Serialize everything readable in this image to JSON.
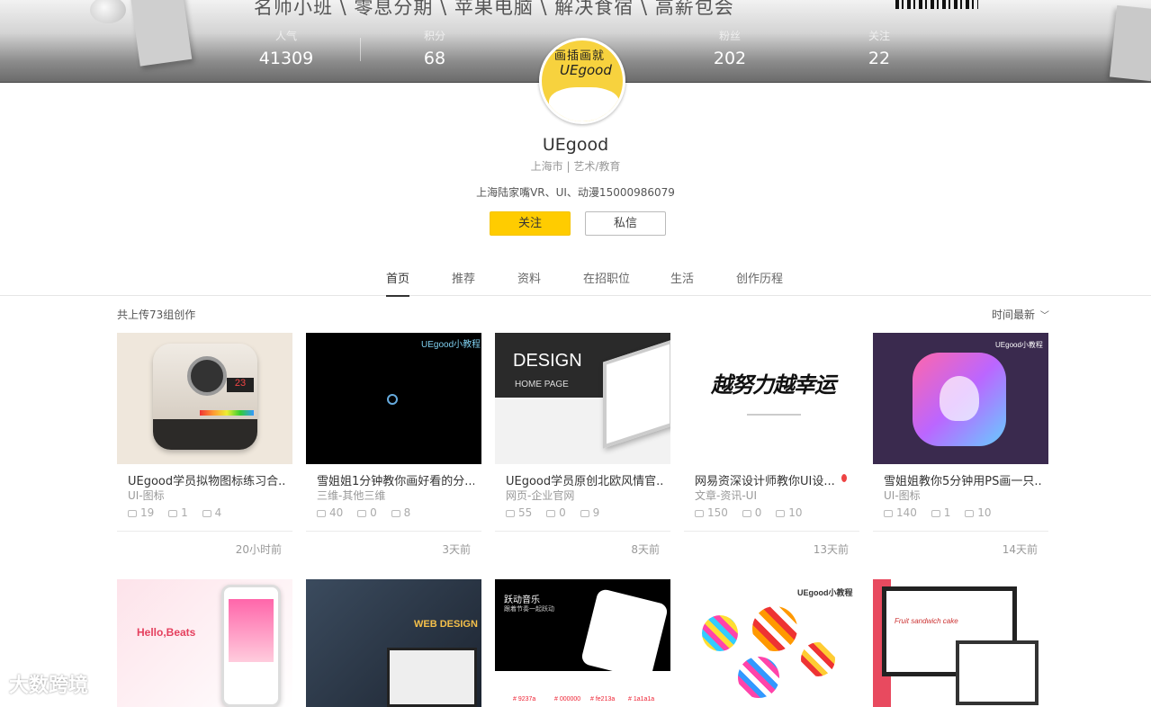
{
  "banner": {
    "slogan": "名师小班 \\ 零息分期 \\ 苹果电脑 \\ 解决食宿 \\ 高薪包会"
  },
  "stats": [
    {
      "label": "人气",
      "value": "41309"
    },
    {
      "label": "积分",
      "value": "68"
    },
    {
      "label": "粉丝",
      "value": "202"
    },
    {
      "label": "关注",
      "value": "22"
    }
  ],
  "avatar": {
    "top_text": "画插画就",
    "brand": "UEgood"
  },
  "profile": {
    "name": "UEgood",
    "meta": "上海市 | 艺术/教育",
    "bio": "上海陆家嘴VR、UI、动漫15000986079"
  },
  "buttons": {
    "follow": "关注",
    "message": "私信"
  },
  "tabs": [
    "首页",
    "推荐",
    "资料",
    "在招职位",
    "生活",
    "创作历程"
  ],
  "works": {
    "count_text": "共上传73组创作",
    "sort_text": "时间最新",
    "items": [
      {
        "title": "UEgood学员拟物图标练习合...",
        "category": "UI-图标",
        "views": "19",
        "comments": "1",
        "likes": "4",
        "time": "20小时前",
        "thumb_text": "23"
      },
      {
        "title": "雪姐姐1分钟教你画好看的分...",
        "category": "三维-其他三维",
        "views": "40",
        "comments": "0",
        "likes": "8",
        "time": "3天前",
        "thumb_text": "UEgood小教程"
      },
      {
        "title": "UEgood学员原创北欧风情官...",
        "category": "网页-企业官网",
        "views": "55",
        "comments": "0",
        "likes": "9",
        "time": "8天前",
        "thumb_text": "DESIGN",
        "thumb_sub": "HOME PAGE"
      },
      {
        "title": "网易资深设计师教你UI设...",
        "category": "文章-资讯-UI",
        "views": "150",
        "comments": "0",
        "likes": "10",
        "time": "13天前",
        "thumb_text": "越努力越幸运"
      },
      {
        "title": "雪姐姐教你5分钟用PS画一只...",
        "category": "UI-图标",
        "views": "140",
        "comments": "1",
        "likes": "10",
        "time": "14天前",
        "thumb_text": "UEgood小教程"
      }
    ],
    "row2": [
      {
        "thumb_text": "Hello,Beats"
      },
      {
        "thumb_text": "WEB DESIGN"
      },
      {
        "thumb_text": "跃动音乐",
        "thumb_sub": "跟着节奏一起跃动",
        "swatches": [
          "# 9237a",
          "# 000000",
          "# fe213a",
          "# 1a1a1a"
        ]
      },
      {
        "thumb_text": "UEgood小教程"
      },
      {
        "thumb_text": "Fruit sandwich cake"
      }
    ]
  },
  "watermark": "大数跨境",
  "colors": {
    "follow_button": "#ffcc00",
    "accent": "#f5c400"
  }
}
